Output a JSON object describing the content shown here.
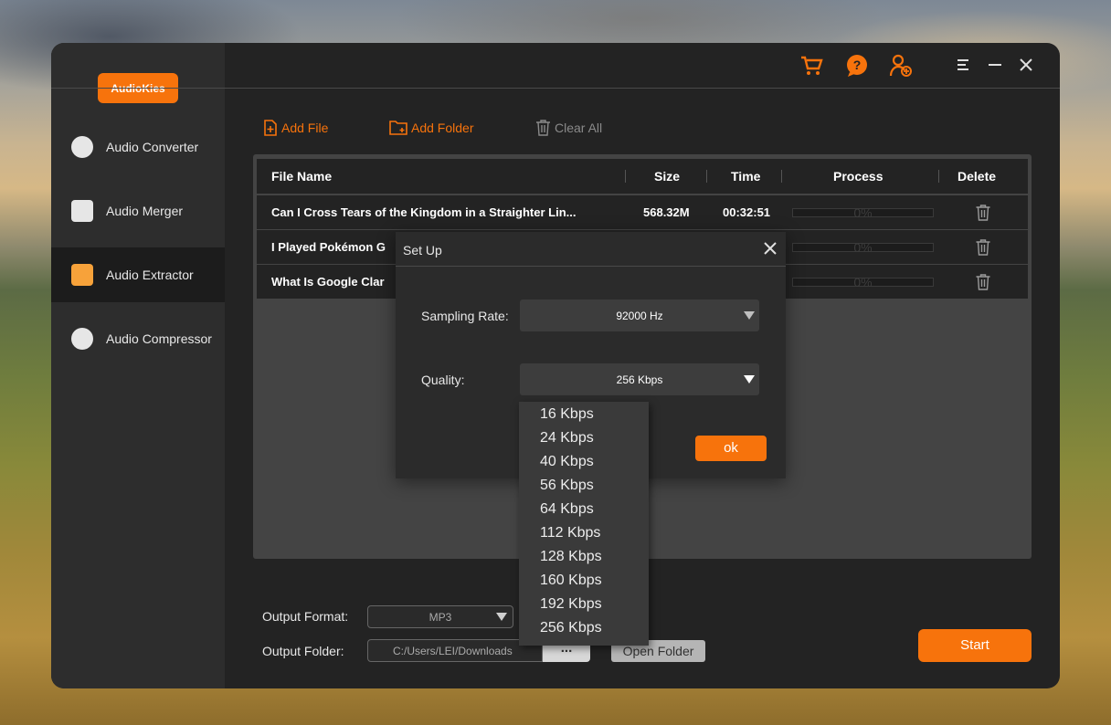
{
  "app": {
    "logo": "AudioKies"
  },
  "sidebar": {
    "items": [
      {
        "label": "Audio Converter"
      },
      {
        "label": "Audio Merger"
      },
      {
        "label": "Audio Extractor"
      },
      {
        "label": "Audio Compressor"
      }
    ]
  },
  "toolbar": {
    "add_file": "Add File",
    "add_folder": "Add Folder",
    "clear_all": "Clear All"
  },
  "table": {
    "headers": [
      "File Name",
      "Size",
      "Time",
      "Process",
      "Delete"
    ],
    "rows": [
      {
        "name": "Can I Cross Tears of the Kingdom in a Straighter Lin...",
        "size": "568.32M",
        "time": "00:32:51",
        "process": "0%"
      },
      {
        "name": "I Played Pokémon G",
        "size": "",
        "time": "",
        "process": "0%"
      },
      {
        "name": "What Is Google Clar",
        "size": "",
        "time": "",
        "process": "0%"
      }
    ]
  },
  "bottom": {
    "output_format_label": "Output Format:",
    "output_format_value": "MP3",
    "output_folder_label": "Output Folder:",
    "output_folder_value": "C:/Users/LEI/Downloads",
    "browse_label": "...",
    "open_folder_label": "Open Folder",
    "start_label": "Start"
  },
  "dialog": {
    "title": "Set Up",
    "sampling_rate_label": "Sampling Rate:",
    "sampling_rate_value": "92000 Hz",
    "quality_label": "Quality:",
    "quality_value": "256 Kbps",
    "ok_label": "ok"
  },
  "quality_options": [
    "16 Kbps",
    "24 Kbps",
    "40 Kbps",
    "56 Kbps",
    "64 Kbps",
    "112 Kbps",
    "128 Kbps",
    "160 Kbps",
    "192 Kbps",
    "256 Kbps"
  ],
  "colors": {
    "accent": "#f7730c",
    "window_bg": "#232323",
    "sidebar_bg": "#2d2d2d"
  }
}
